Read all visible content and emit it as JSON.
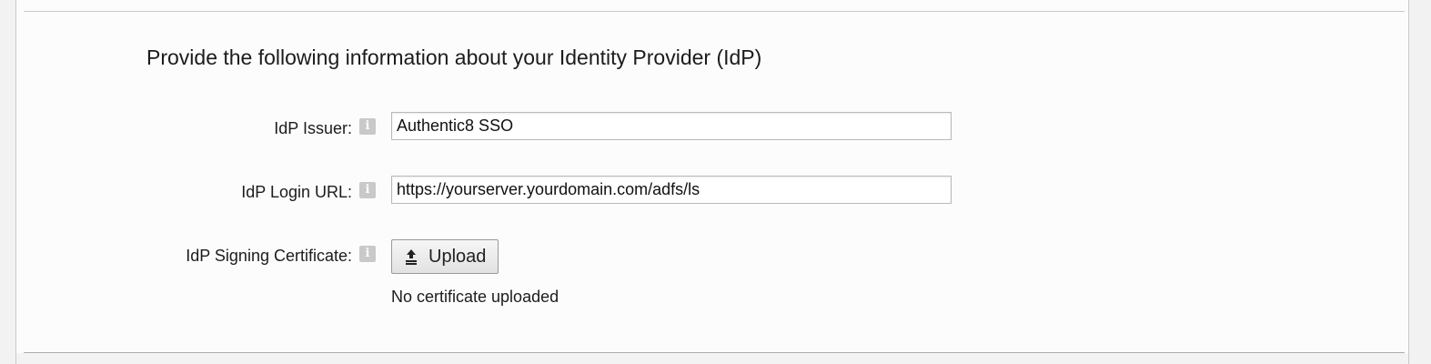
{
  "section": {
    "heading": "Provide the following information about your Identity Provider (IdP)"
  },
  "fields": {
    "issuer": {
      "label": "IdP Issuer:",
      "value": "Authentic8 SSO",
      "info_icon": "info-icon"
    },
    "login_url": {
      "label": "IdP Login URL:",
      "value": "https://yourserver.yourdomain.com/adfs/ls",
      "info_icon": "info-icon"
    },
    "signing_certificate": {
      "label": "IdP Signing Certificate:",
      "info_icon": "info-icon",
      "upload_label": "Upload",
      "upload_icon": "upload-arrow-icon",
      "status": "No certificate uploaded"
    }
  },
  "colors": {
    "panel_background": "#fdfcfd",
    "info_icon": "#c9c9c9",
    "input_border": "#b9b9b9"
  }
}
